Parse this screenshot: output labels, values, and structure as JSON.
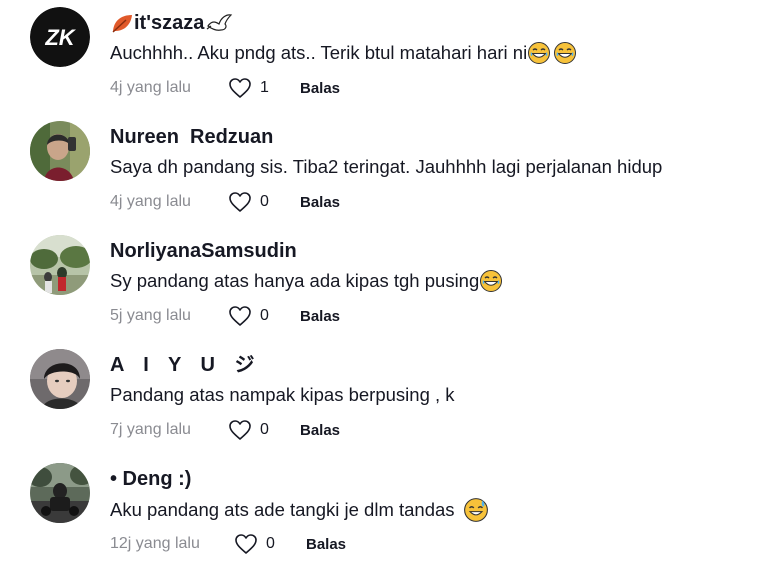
{
  "comments": [
    {
      "username": "it'szaza",
      "text": "Auchhhh.. Aku pndg ats.. Terik btul matahari hari ni",
      "text_emoji": [
        "grinning-sweat-emoji",
        "grinning-sweat-emoji"
      ],
      "time": "4j yang lalu",
      "likes": "1",
      "reply_label": "Balas",
      "avatar": "zk-logo"
    },
    {
      "username": "Nureen  Redzuan",
      "text": "Saya dh pandang sis. Tiba2 teringat. Jauhhhh lagi perjalanan hidup",
      "time": "4j yang lalu",
      "likes": "0",
      "reply_label": "Balas",
      "avatar": "photo"
    },
    {
      "username": "NorliyanaSamsudin",
      "text": "Sy pandang atas hanya ada kipas tgh pusing",
      "text_emoji": [
        "grinning-sweat-emoji"
      ],
      "time": "5j yang lalu",
      "likes": "0",
      "reply_label": "Balas",
      "avatar": "photo"
    },
    {
      "username": "A I Y U ジ",
      "text": "Pandang atas nampak kipas berpusing , k",
      "time": "7j yang lalu",
      "likes": "0",
      "reply_label": "Balas",
      "avatar": "photo"
    },
    {
      "username": "• Deng :)",
      "text": "Aku pandang ats ade tangki je dlm tandas",
      "text_emoji": [
        "sweat-smile-emoji"
      ],
      "time": "12j yang lalu",
      "likes": "0",
      "reply_label": "Balas",
      "avatar": "photo"
    }
  ],
  "colors": {
    "text": "#161823",
    "muted": "#8a8b91",
    "background": "#ffffff"
  }
}
